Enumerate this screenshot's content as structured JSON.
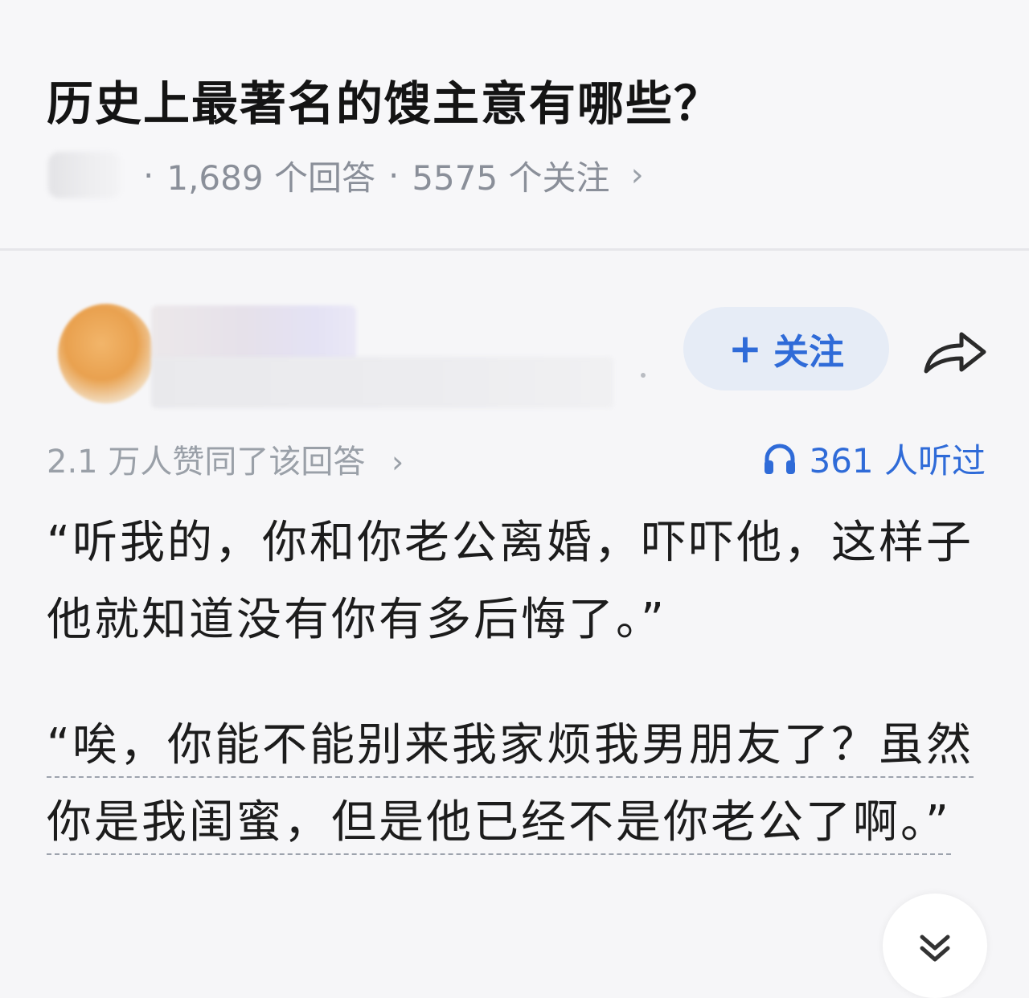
{
  "question": {
    "title": "历史上最著名的馊主意有哪些？",
    "answers_count": "1,689 个回答",
    "follows_count": "5575 个关注",
    "separator": "·",
    "chevron": "›"
  },
  "author": {
    "follow_label": "关注",
    "follow_plus": "+",
    "share_icon": "share-arrow-icon"
  },
  "stats": {
    "agree_text": "2.1 万人赞同了该回答",
    "agree_chevron": "›",
    "listened_text": "361 人听过",
    "listen_icon": "headphones-icon"
  },
  "answer": {
    "paragraph1": "“听我的，你和你老公离婚，吓吓他，这样子他就知道没有你有多后悔了。”",
    "paragraph2": "“唉，你能不能别来我家烦我男朋友了？虽然你是我闺蜜，但是他已经不是你老公了啊。”"
  },
  "colors": {
    "accent": "#2f6bd8",
    "muted": "#9aa0a8",
    "follow_bg": "#e6ecf6"
  }
}
